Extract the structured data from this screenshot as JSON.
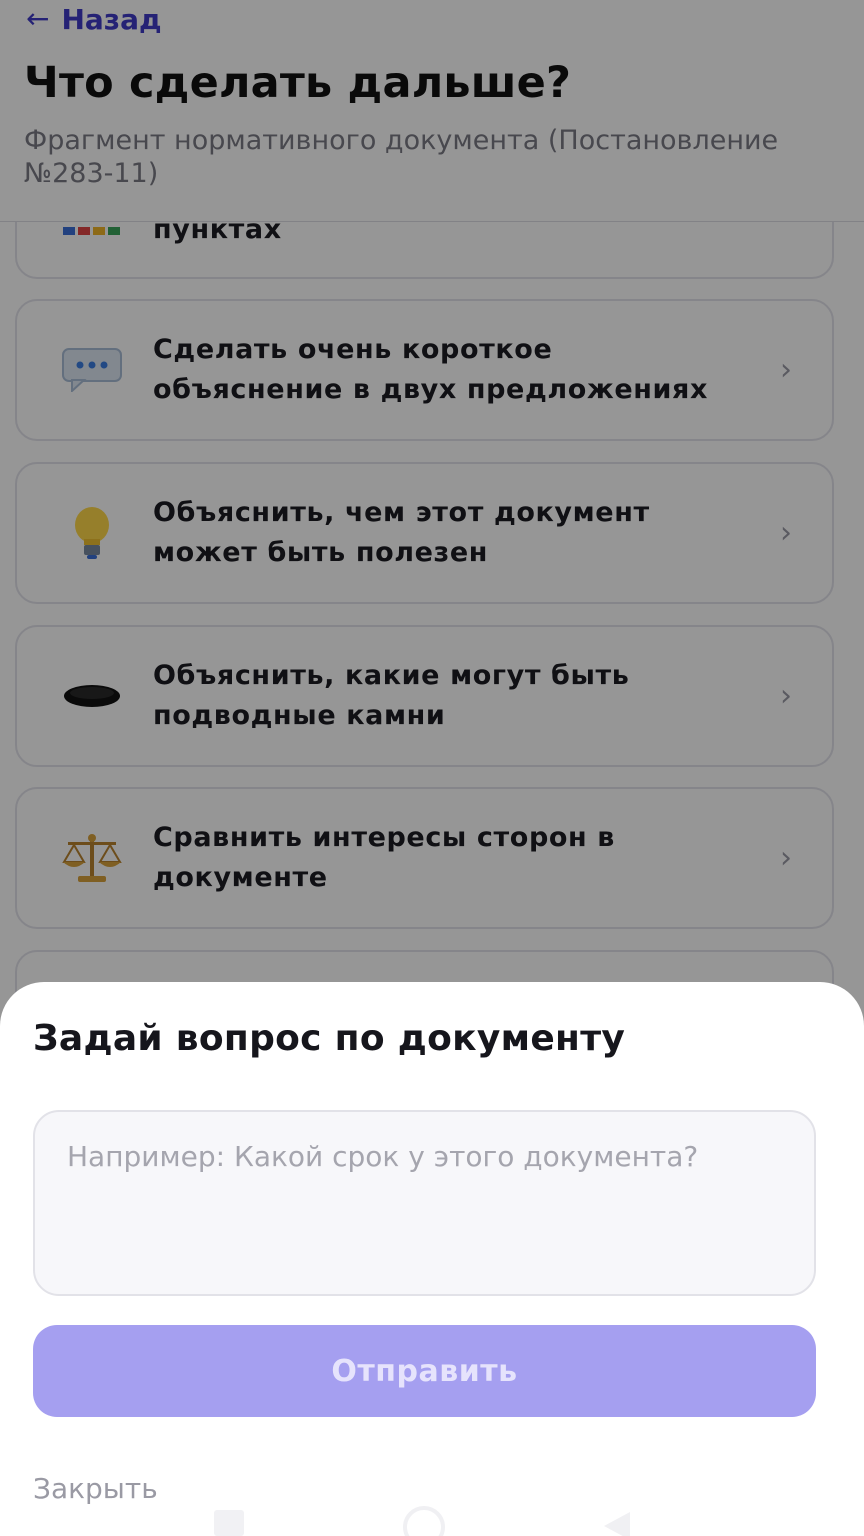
{
  "header": {
    "back_label": "Назад",
    "title": "Что сделать дальше?",
    "subtitle": "Фрагмент нормативного документа (Постановление №283-11)"
  },
  "options": [
    {
      "label": "пунктах",
      "icon": "color-bars-icon"
    },
    {
      "label": "Сделать очень короткое объяснение в двух предложениях",
      "icon": "speech-bubble-icon"
    },
    {
      "label": "Объяснить, чем этот документ может быть полезен",
      "icon": "lightbulb-icon"
    },
    {
      "label": "Объяснить, какие могут быть подводные камни",
      "icon": "hole-icon"
    },
    {
      "label": "Сравнить интересы сторон в документе",
      "icon": "balance-scale-icon"
    }
  ],
  "chevron": "›",
  "sheet": {
    "title": "Задай вопрос по документу",
    "input_placeholder": "Например: Какой срок у этого документа?",
    "input_value": "",
    "send_label": "Отправить",
    "close_label": "Закрыть"
  },
  "colors": {
    "accent": "#3f3ac8",
    "button_disabled": "#a59ff0",
    "overlay": "rgba(0,0,0,0.41)"
  }
}
